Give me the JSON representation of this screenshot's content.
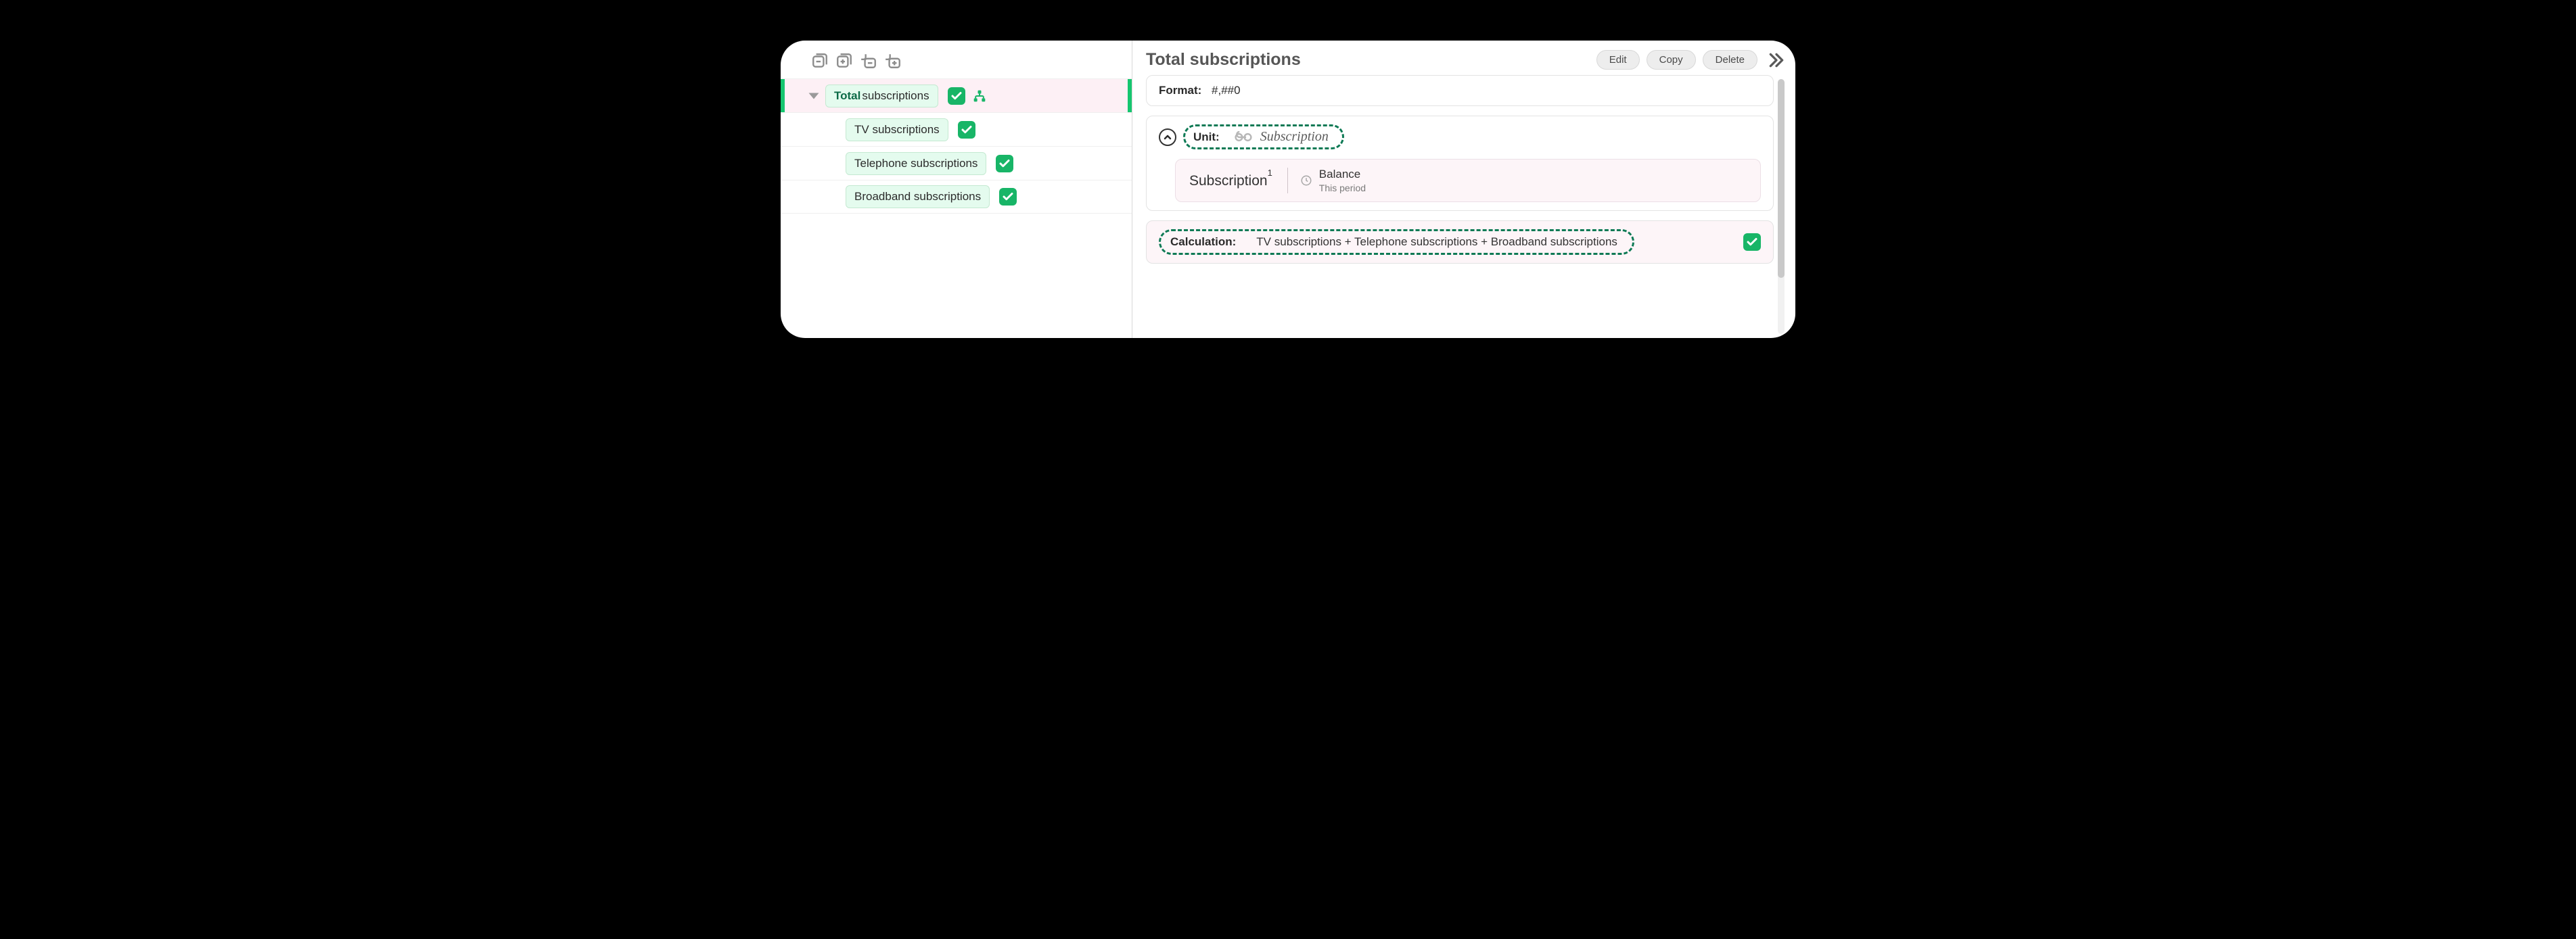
{
  "tree": {
    "root": {
      "bold": "Total",
      "rest": " subscriptions"
    },
    "items": [
      {
        "label": "TV subscriptions"
      },
      {
        "label": "Telephone subscriptions"
      },
      {
        "label": "Broadband subscriptions"
      }
    ]
  },
  "detail": {
    "title": "Total subscriptions",
    "actions": {
      "edit": "Edit",
      "copy": "Copy",
      "delete": "Delete"
    },
    "format": {
      "label": "Format:",
      "value": "#,##0"
    },
    "unit": {
      "label": "Unit:",
      "value": "Subscription"
    },
    "unit_card": {
      "name": "Subscription",
      "super": "1",
      "balance_label": "Balance",
      "period_label": "This period"
    },
    "calculation": {
      "label": "Calculation:",
      "formula": "TV subscriptions + Telephone subscriptions + Broadband subscriptions"
    }
  }
}
